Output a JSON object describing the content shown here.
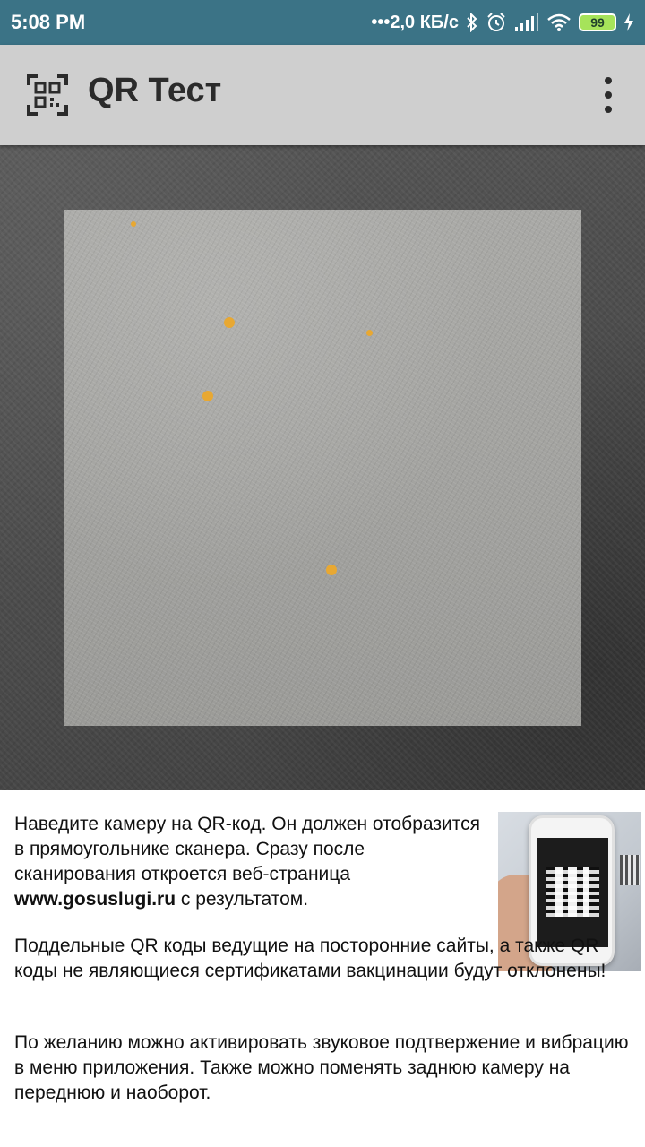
{
  "status_bar": {
    "time": "5:08 PM",
    "network_speed": "•••2,0 КБ/с",
    "battery_level": "99",
    "icons": [
      "bluetooth-icon",
      "alarm-icon",
      "signal-icon",
      "wifi-icon",
      "battery-icon",
      "charging-icon"
    ]
  },
  "app_bar": {
    "title": "QR Тест",
    "logo_icon": "qr-scan-icon",
    "menu_icon": "more-vert-icon"
  },
  "camera": {
    "scanner_frame": "scan-window"
  },
  "instructions": {
    "p1_start": "Наведите камеру на QR-код. Он должен отобразится в прямоугольнике сканера. Сразу после сканирования откроется веб-страница ",
    "p1_link": "www.gosuslugi.ru",
    "p1_end": " с результатом.",
    "p2": "Поддельные QR коды ведущие на посторонние сайты, а также QR коды не являющиеся сертификатами вакцинации будут отклонены!",
    "p3": "По желанию можно активировать звуковое подтвержение и вибрацию в меню приложения. Также можно поменять заднюю камеру на переднюю и наоборот."
  },
  "colors": {
    "status_bar": "#3b7386",
    "app_bar": "#cfcfcf",
    "scan_points": "#e8a832"
  }
}
